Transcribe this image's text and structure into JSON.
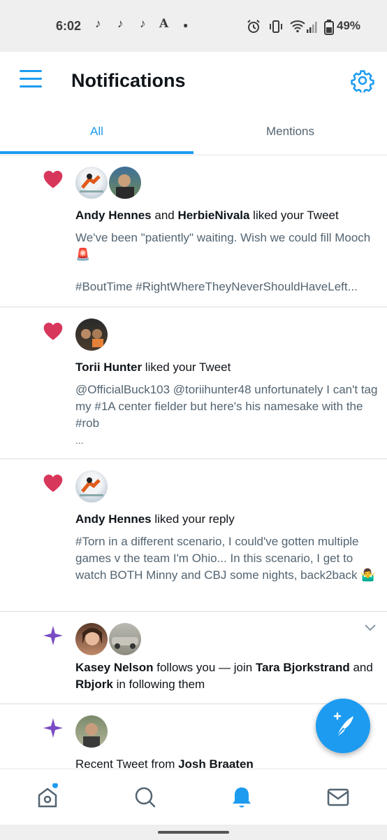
{
  "status_bar": {
    "time": "6:02",
    "battery": "49%",
    "left_icons": [
      "tiktok-icon",
      "tiktok-icon",
      "tiktok-icon",
      "font-app-icon",
      "dot-icon"
    ],
    "right_icons": [
      "alarm-icon",
      "vibrate-icon",
      "wifi-icon",
      "signal-icon",
      "battery-icon"
    ]
  },
  "header": {
    "title": "Notifications",
    "menu_icon": "hamburger-menu-icon",
    "settings_icon": "gear-icon"
  },
  "tabs": [
    {
      "label": "All",
      "active": true
    },
    {
      "label": "Mentions",
      "active": false
    }
  ],
  "notifications": [
    {
      "icon": "heart-icon",
      "avatars": 2,
      "line": {
        "name1": "Andy Hennes",
        "joiner": " and ",
        "name2": "HerbieNivala",
        "suffix": " liked your Tweet"
      },
      "body": "We've been \"patiently\" waiting. Wish we could fill Mooch 🚨",
      "body2": "#BoutTime #RightWhereTheyNeverShouldHaveLeft..."
    },
    {
      "icon": "heart-icon",
      "avatars": 1,
      "line": {
        "name1": "Torii Hunter",
        "suffix": " liked your Tweet"
      },
      "body": "@OfficialBuck103 @toriihunter48 unfortunately I can't tag my #1A center fielder but here's his namesake with the #rob",
      "body2": "..."
    },
    {
      "icon": "heart-icon",
      "avatars": 1,
      "line": {
        "name1": "Andy Hennes",
        "suffix": " liked your reply"
      },
      "body": "#Torn in a different scenario, I could've gotten multiple games v the team I'm Ohio... In this scenario, I get to watch BOTH Minny and CBJ some nights, back2back 🤷‍♂️"
    },
    {
      "icon": "sparkle-icon",
      "avatars": 2,
      "line": {
        "name1": "Kasey Nelson",
        "mid": " follows you — join ",
        "name2": "Tara Bjorkstrand",
        "joiner": " and ",
        "name3": "Rbjork",
        "suffix": " in following them"
      }
    },
    {
      "icon": "sparkle-icon",
      "avatars": 1,
      "line": {
        "prefix": "Recent Tweet from ",
        "name1": "Josh Braaten"
      }
    }
  ],
  "fab": {
    "icon": "compose-tweet-icon"
  },
  "bottom_nav": [
    {
      "icon": "home-icon",
      "active": false,
      "badge": true
    },
    {
      "icon": "search-icon",
      "active": false
    },
    {
      "icon": "bell-icon",
      "active": true
    },
    {
      "icon": "mail-icon",
      "active": false
    }
  ],
  "colors": {
    "accent": "#1d9bf0",
    "heart": "#f91880",
    "sparkle": "#794bc4",
    "secondary_text": "#536471"
  }
}
